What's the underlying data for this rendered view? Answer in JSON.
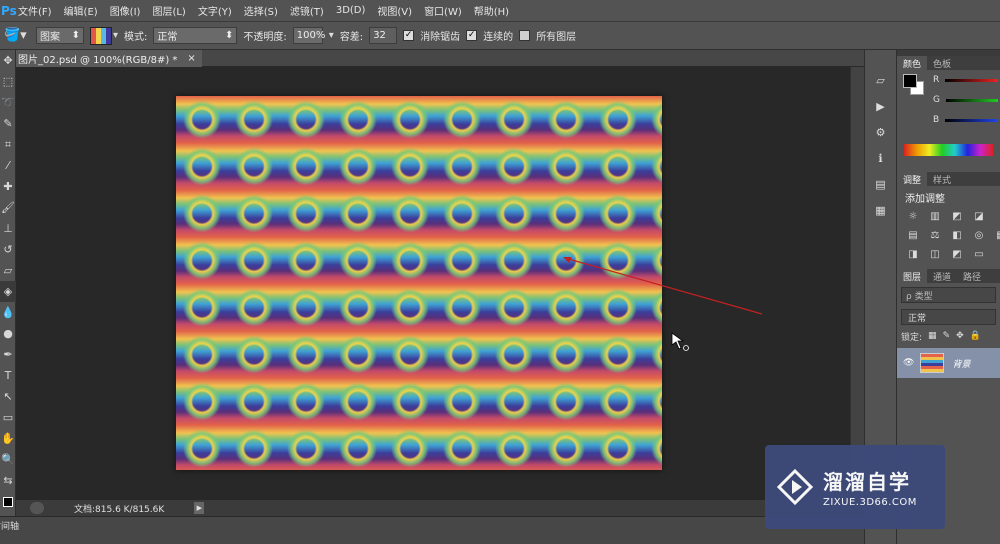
{
  "app": {
    "logo": "Ps"
  },
  "menu": [
    "文件(F)",
    "编辑(E)",
    "图像(I)",
    "图层(L)",
    "文字(Y)",
    "选择(S)",
    "滤镜(T)",
    "3D(D)",
    "视图(V)",
    "窗口(W)",
    "帮助(H)"
  ],
  "options": {
    "fill_source": "图案",
    "mode_label": "模式:",
    "mode_value": "正常",
    "opacity_label": "不透明度:",
    "opacity_value": "100%",
    "tolerance_label": "容差:",
    "tolerance_value": "32",
    "antialias_label": "消除锯齿",
    "antialias_checked": true,
    "contiguous_label": "连续的",
    "contiguous_checked": true,
    "all_layers_label": "所有图层",
    "all_layers_checked": false
  },
  "document": {
    "tab_title": "图片_02.psd @ 100%(RGB/8#) *",
    "close": "×",
    "status": "文档:815.6 K/815.6K",
    "bottom_label": "时间轴"
  },
  "panels": {
    "color": {
      "tabs": [
        "颜色",
        "色板"
      ],
      "channels": [
        "R",
        "G",
        "B"
      ],
      "colors": {
        "r": "#c02020",
        "g": "#20a020",
        "b": "#2040d0"
      }
    },
    "adjustments": {
      "tabs": [
        "调整",
        "样式"
      ],
      "title": "添加调整"
    },
    "layers": {
      "tabs": [
        "图层",
        "通道",
        "路径"
      ],
      "search_placeholder": "ρ 类型",
      "blend_mode": "正常",
      "lock_label": "锁定:",
      "layer_name": "背景"
    }
  },
  "watermark": {
    "title": "溜溜自学",
    "subtitle": "ZIXUE.3D66.COM"
  }
}
